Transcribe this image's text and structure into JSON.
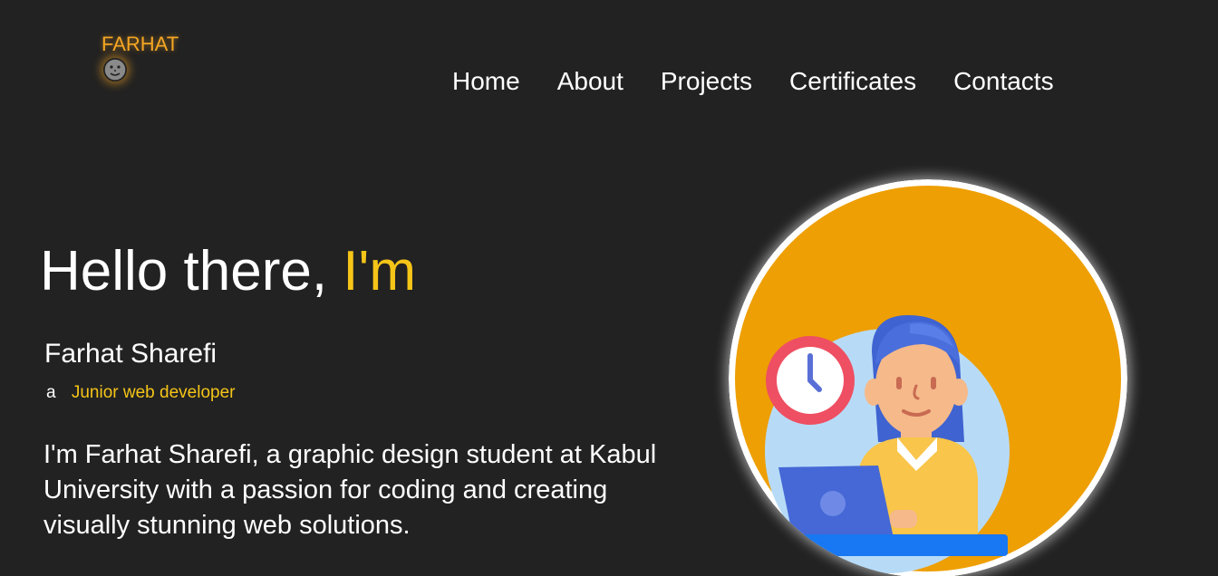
{
  "brand": {
    "name": "FARHAT",
    "icon": "face-icon",
    "color": "#f5a623"
  },
  "nav": {
    "items": [
      {
        "label": "Home"
      },
      {
        "label": "About"
      },
      {
        "label": "Projects"
      },
      {
        "label": "Certificates"
      },
      {
        "label": "Contacts"
      }
    ]
  },
  "hero": {
    "greeting": "Hello there,",
    "greeting_accent": "I'm",
    "name": "Farhat Sharefi",
    "role_prefix": "a",
    "role": "Junior web developer",
    "bio": "I'm Farhat Sharefi, a graphic design student at Kabul University with a passion for coding and creating visually stunning web solutions.",
    "accent_color": "#f5c518"
  },
  "avatar": {
    "illustration": "woman-at-laptop-illustration",
    "background_color": "#ee9f04"
  }
}
